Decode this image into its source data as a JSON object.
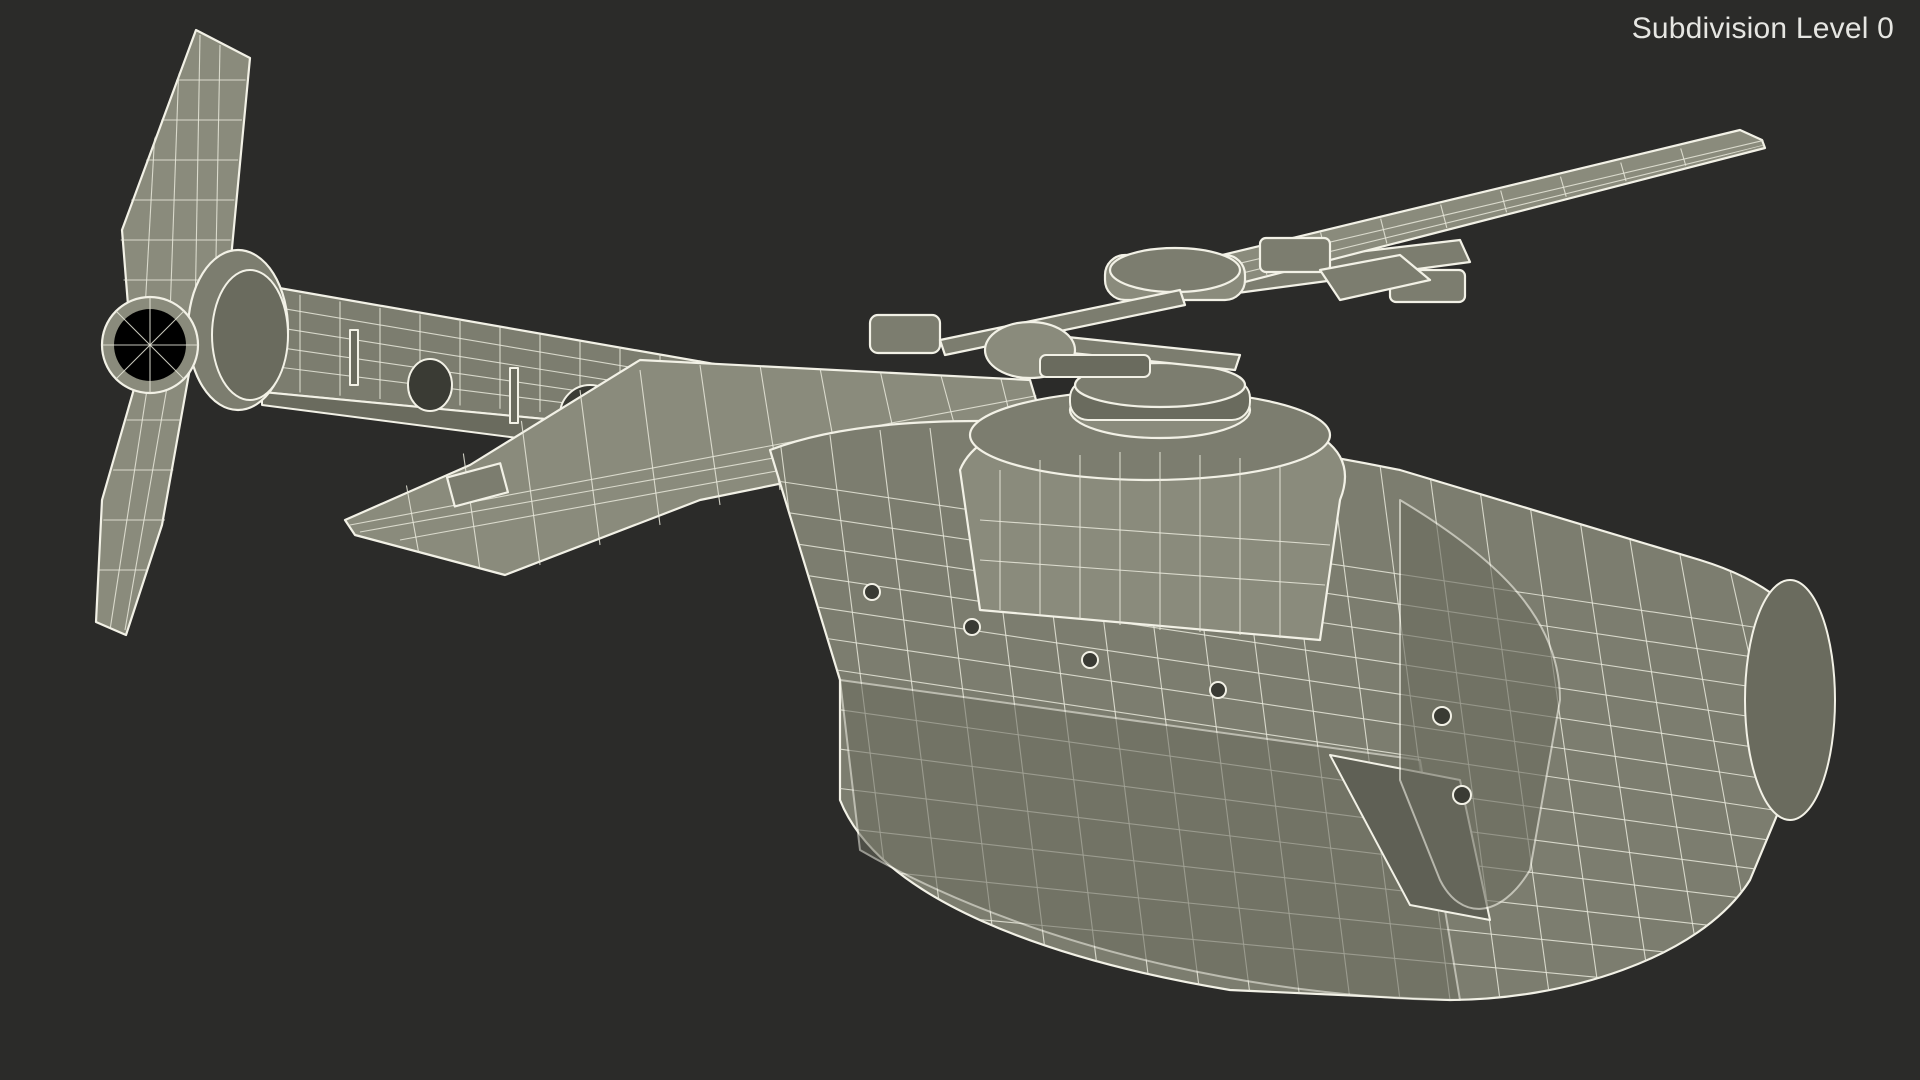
{
  "viewport": {
    "label": "Subdivision Level 0",
    "background_color": "#2b2b29",
    "model_color": "#7c7d6f",
    "wireframe_color": "#f2f1e6"
  }
}
